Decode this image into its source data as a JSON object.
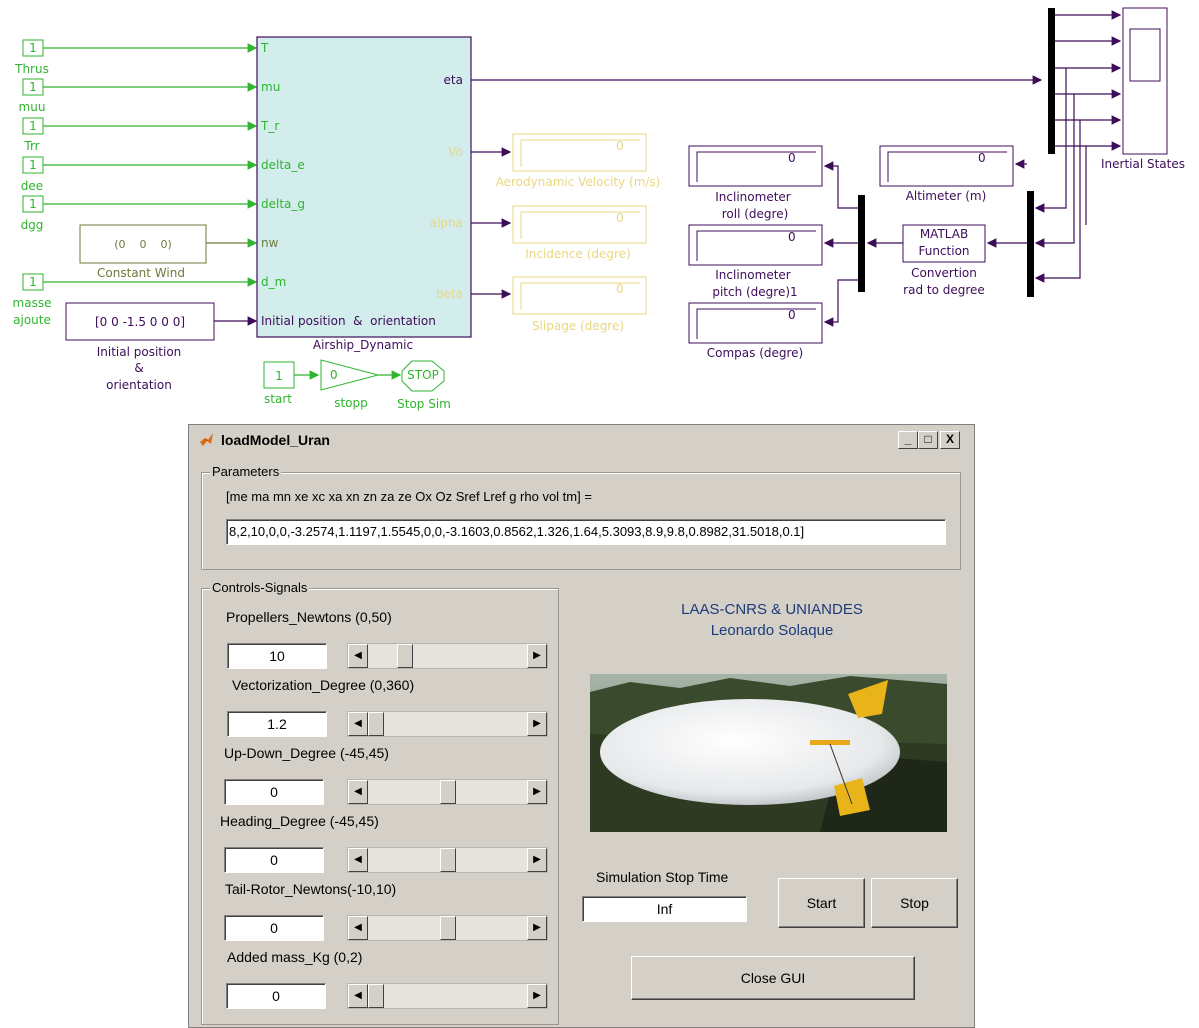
{
  "diagram": {
    "constants": [
      {
        "value": "1",
        "label": "Thrus"
      },
      {
        "value": "1",
        "label": "muu"
      },
      {
        "value": "1",
        "label": "Trr"
      },
      {
        "value": "1",
        "label": "dee"
      },
      {
        "value": "1",
        "label": "dgg"
      },
      {
        "value": "1",
        "label_line1": "masse",
        "label_line2": "ajoute"
      }
    ],
    "constant_wind": {
      "value": "(0    0    0)",
      "label": "Constant Wind"
    },
    "initial_position": {
      "value": "[0 0 -1.5 0 0 0]",
      "label_line1": "Initial position",
      "label_line2": "&",
      "label_line3": "orientation"
    },
    "airship": {
      "name": "Airship_Dynamic",
      "inputs": [
        "T",
        "mu",
        "T_r",
        "delta_e",
        "delta_g",
        "nw",
        "d_m",
        "Initial position  &  orientation"
      ],
      "outputs": [
        "eta",
        "Vo",
        "alpha",
        "beta"
      ]
    },
    "displays_left": [
      {
        "value": "0",
        "label": "Aerodynamic Velocity (m/s)"
      },
      {
        "value": "0",
        "label": "Incidence (degre)"
      },
      {
        "value": "0",
        "label": "Slipage (degre)"
      }
    ],
    "displays_right": [
      {
        "value": "0",
        "label_line1": "Inclinometer",
        "label_line2": "roll (degre)"
      },
      {
        "value": "0",
        "label_line1": "Inclinometer",
        "label_line2": "pitch (degre)1"
      },
      {
        "value": "0",
        "label": "Compas (degre)"
      }
    ],
    "altimeter": {
      "value": "0",
      "label": "Altimeter (m)"
    },
    "matlab_fcn": {
      "text_line1": "MATLAB",
      "text_line2": "Function",
      "label_line1": "Convertion",
      "label_line2": "rad to degree"
    },
    "scope_label": "Inertial States",
    "start": {
      "value": "1",
      "label": "start"
    },
    "gain": {
      "value": "0",
      "label": "stopp"
    },
    "stop_block": {
      "text": "STOP",
      "label": "Stop Sim"
    }
  },
  "window": {
    "title": "loadModel_Uran",
    "buttons": {
      "minimize": "_",
      "maximize": "□",
      "close": "X"
    },
    "parameters": {
      "group_title": "Parameters",
      "label": "[me ma mn xe xc xa xn zn za ze Ox Oz Sref Lref g rho vol tm] =",
      "value": "8,2,10,0,0,-3.2574,1.1197,1.5545,0,0,-3.1603,0.8562,1.326,1.64,5.3093,8.9,9.8,0.8982,31.5018,0.1]"
    },
    "controls": {
      "group_title": "Controls-Signals",
      "items": [
        {
          "label": "Propellers_Newtons (0,50)",
          "value": "10",
          "fraction": 0.2
        },
        {
          "label": "Vectorization_Degree (0,360)",
          "value": "1.2",
          "fraction": 0.0
        },
        {
          "label": "Up-Down_Degree (-45,45)",
          "value": "0",
          "fraction": 0.5
        },
        {
          "label": "Heading_Degree (-45,45)",
          "value": "0",
          "fraction": 0.5
        },
        {
          "label": "Tail-Rotor_Newtons(-10,10)",
          "value": "0",
          "fraction": 0.5
        },
        {
          "label": "Added mass_Kg (0,2)",
          "value": "0",
          "fraction": 0.0
        }
      ]
    },
    "credits": {
      "line1": "LAAS-CNRS   &   UNIANDES",
      "line2": "Leonardo Solaque"
    },
    "stop_time": {
      "label": "Simulation Stop Time",
      "value": "Inf"
    },
    "start_button": "Start",
    "stop_button": "Stop",
    "close_button": "Close GUI"
  }
}
